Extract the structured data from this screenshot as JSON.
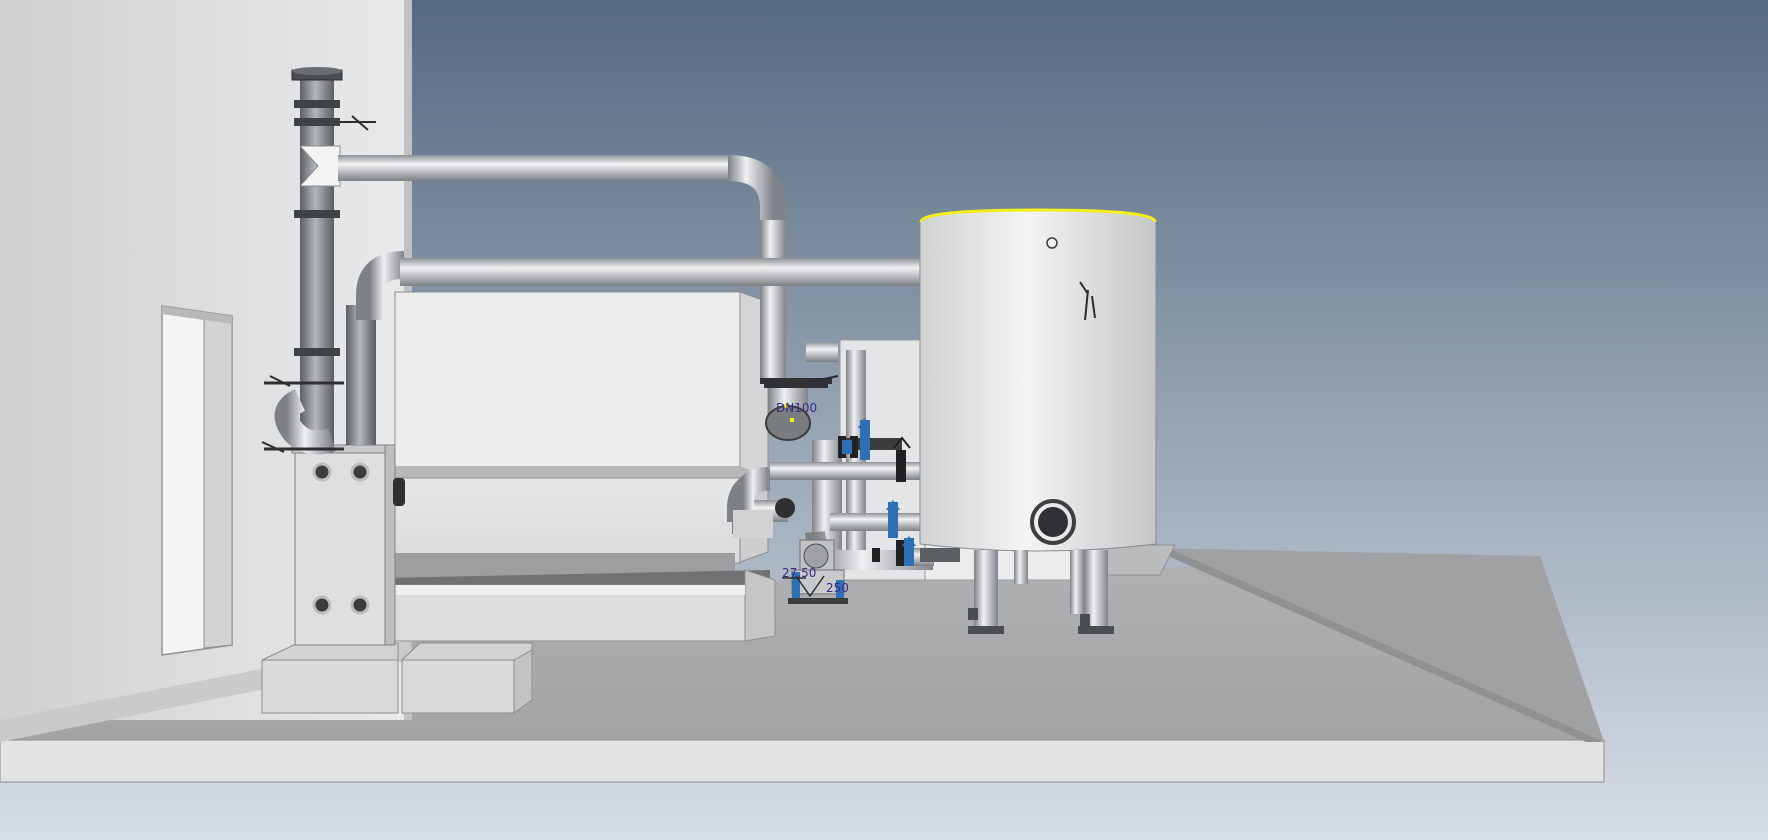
{
  "viewport": {
    "background_top": "#566a80",
    "background_bottom": "#d6dde6",
    "selection_highlight": "#f2ee1a",
    "dimension_text_color": "#3d2a8c",
    "valve_handle_color": "#2f6fb3"
  },
  "annotations": {
    "dim_pipe_diameter": "DN100",
    "dim_pump_left": "27.50",
    "dim_pump_right": "250"
  }
}
